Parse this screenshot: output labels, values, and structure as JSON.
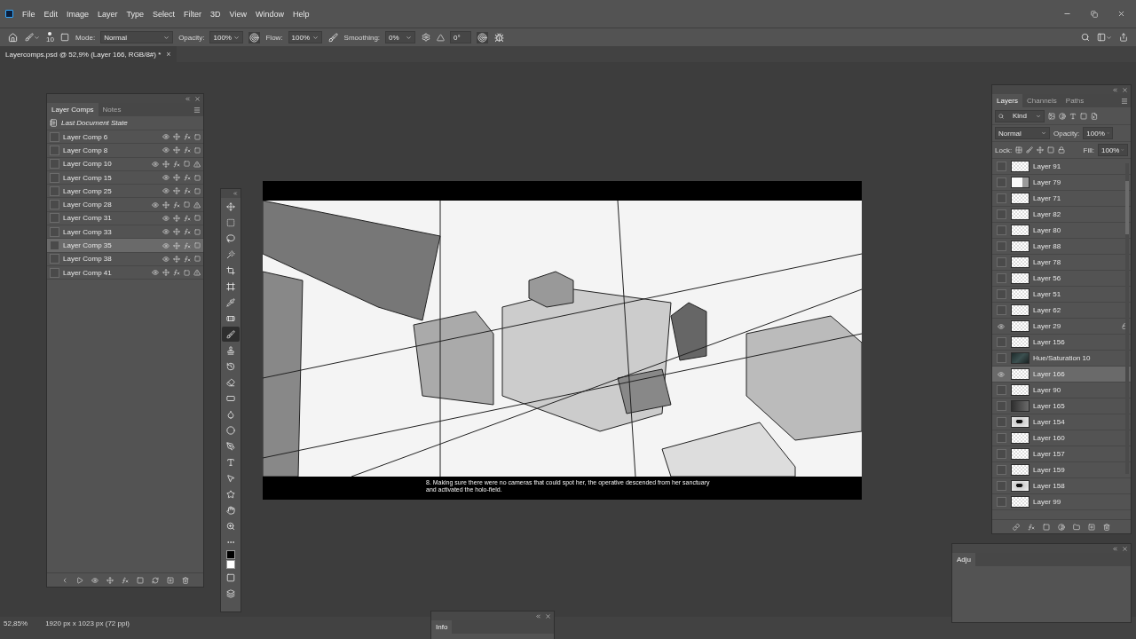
{
  "menu": [
    "File",
    "Edit",
    "Image",
    "Layer",
    "Type",
    "Select",
    "Filter",
    "3D",
    "View",
    "Window",
    "Help"
  ],
  "options": {
    "brush_size": "10",
    "mode_label": "Mode:",
    "mode": "Normal",
    "opacity_label": "Opacity:",
    "opacity": "100%",
    "flow_label": "Flow:",
    "flow": "100%",
    "smoothing_label": "Smoothing:",
    "smoothing": "0%",
    "angle": "0°"
  },
  "document_tab": {
    "title": "Layercomps.psd @ 52,9% (Layer 166, RGB/8#) *",
    "close": "×"
  },
  "layer_comps": {
    "tabs": [
      {
        "label": "Layer Comps",
        "selected": true
      },
      {
        "label": "Notes",
        "selected": false
      }
    ],
    "last_state": "Last Document State",
    "comps": [
      {
        "name": "Layer Comp 6",
        "selected": false,
        "warning": false
      },
      {
        "name": "Layer Comp 8",
        "selected": false,
        "warning": false
      },
      {
        "name": "Layer Comp 10",
        "selected": false,
        "warning": true
      },
      {
        "name": "Layer Comp 15",
        "selected": false,
        "warning": false
      },
      {
        "name": "Layer Comp 25",
        "selected": false,
        "warning": false
      },
      {
        "name": "Layer Comp 28",
        "selected": false,
        "warning": true
      },
      {
        "name": "Layer Comp 31",
        "selected": false,
        "warning": false
      },
      {
        "name": "Layer Comp 33",
        "selected": false,
        "warning": false
      },
      {
        "name": "Layer Comp 35",
        "selected": true,
        "warning": false
      },
      {
        "name": "Layer Comp 38",
        "selected": false,
        "warning": false
      },
      {
        "name": "Layer Comp 41",
        "selected": false,
        "warning": true
      }
    ]
  },
  "tools": [
    {
      "kind": "move",
      "selected": false
    },
    {
      "kind": "marquee",
      "selected": false
    },
    {
      "kind": "lasso",
      "selected": false
    },
    {
      "kind": "wand",
      "selected": false
    },
    {
      "kind": "crop",
      "selected": false
    },
    {
      "kind": "frame",
      "selected": false
    },
    {
      "kind": "eyedropper",
      "selected": false
    },
    {
      "kind": "healing",
      "selected": false
    },
    {
      "kind": "brush",
      "selected": true
    },
    {
      "kind": "stamp",
      "selected": false
    },
    {
      "kind": "history",
      "selected": false
    },
    {
      "kind": "eraser",
      "selected": false
    },
    {
      "kind": "gradient",
      "selected": false
    },
    {
      "kind": "blur",
      "selected": false
    },
    {
      "kind": "dodge",
      "selected": false
    },
    {
      "kind": "pen",
      "selected": false
    },
    {
      "kind": "type",
      "selected": false
    },
    {
      "kind": "select",
      "selected": false
    },
    {
      "kind": "shape",
      "selected": false
    },
    {
      "kind": "hand",
      "selected": false
    },
    {
      "kind": "zoom",
      "selected": false
    },
    {
      "kind": "more",
      "selected": false
    }
  ],
  "caption": "8. Making sure there were no cameras that could spot her, the operative descended from her sanctuary and activated the holo-field.",
  "layers_panel": {
    "tabs": [
      {
        "label": "Layers",
        "selected": true
      },
      {
        "label": "Channels",
        "selected": false
      },
      {
        "label": "Paths",
        "selected": false
      }
    ],
    "filter": "Kind",
    "blend": "Normal",
    "opacity_label": "Opacity:",
    "opacity": "100%",
    "lock_label": "Lock:",
    "fill_label": "Fill:",
    "fill": "100%",
    "layers": [
      {
        "name": "Layer 91",
        "visible": false,
        "selected": false,
        "locked": false,
        "kind": "transparent"
      },
      {
        "name": "Layer 79",
        "visible": false,
        "selected": false,
        "locked": false,
        "kind": "partial"
      },
      {
        "name": "Layer 71",
        "visible": false,
        "selected": false,
        "locked": false,
        "kind": "transparent"
      },
      {
        "name": "Layer 82",
        "visible": false,
        "selected": false,
        "locked": false,
        "kind": "transparent"
      },
      {
        "name": "Layer 80",
        "visible": false,
        "selected": false,
        "locked": false,
        "kind": "transparent"
      },
      {
        "name": "Layer 88",
        "visible": false,
        "selected": false,
        "locked": false,
        "kind": "transparent"
      },
      {
        "name": "Layer 78",
        "visible": false,
        "selected": false,
        "locked": false,
        "kind": "transparent"
      },
      {
        "name": "Layer 56",
        "visible": false,
        "selected": false,
        "locked": false,
        "kind": "transparent"
      },
      {
        "name": "Layer 51",
        "visible": false,
        "selected": false,
        "locked": false,
        "kind": "transparent"
      },
      {
        "name": "Layer 62",
        "visible": false,
        "selected": false,
        "locked": false,
        "kind": "transparent"
      },
      {
        "name": "Layer 29",
        "visible": true,
        "selected": false,
        "locked": true,
        "kind": "transparent"
      },
      {
        "name": "Layer 156",
        "visible": false,
        "selected": false,
        "locked": false,
        "kind": "transparent"
      },
      {
        "name": "Hue/Saturation 10",
        "visible": false,
        "selected": false,
        "locked": false,
        "kind": "adjustment"
      },
      {
        "name": "Layer 166",
        "visible": true,
        "selected": true,
        "locked": false,
        "kind": "transparent"
      },
      {
        "name": "Layer 90",
        "visible": false,
        "selected": false,
        "locked": false,
        "kind": "transparent"
      },
      {
        "name": "Layer 165",
        "visible": false,
        "selected": false,
        "locked": false,
        "kind": "dark"
      },
      {
        "name": "Layer 154",
        "visible": false,
        "selected": false,
        "locked": false,
        "kind": "sketch"
      },
      {
        "name": "Layer 160",
        "visible": false,
        "selected": false,
        "locked": false,
        "kind": "transparent"
      },
      {
        "name": "Layer 157",
        "visible": false,
        "selected": false,
        "locked": false,
        "kind": "transparent"
      },
      {
        "name": "Layer 159",
        "visible": false,
        "selected": false,
        "locked": false,
        "kind": "transparent"
      },
      {
        "name": "Layer 158",
        "visible": false,
        "selected": false,
        "locked": false,
        "kind": "sketch"
      },
      {
        "name": "Layer 99",
        "visible": false,
        "selected": false,
        "locked": false,
        "kind": "transparent"
      }
    ]
  },
  "adjustments_panel": {
    "title": "Adju"
  },
  "info_panel": {
    "title": "Info"
  },
  "status_bar": {
    "zoom": "52,85%",
    "size": "1920 px x 1023 px (72 ppi)"
  }
}
